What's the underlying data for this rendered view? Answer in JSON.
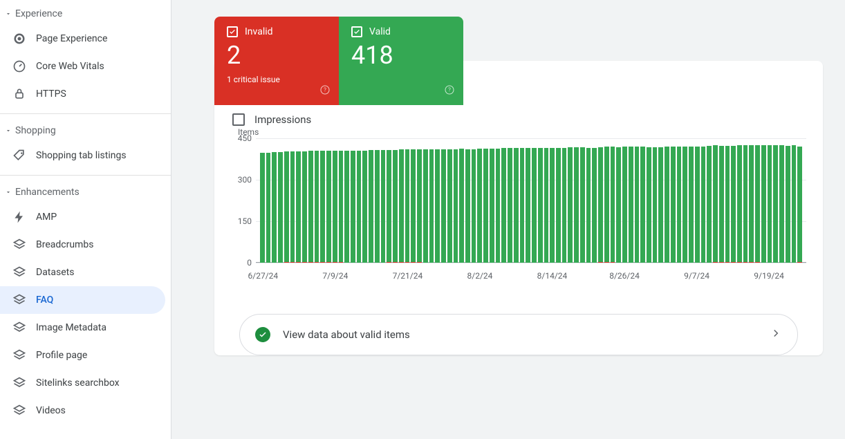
{
  "sidebar": {
    "sections": [
      {
        "title": "Experience",
        "items": [
          {
            "label": "Page Experience",
            "icon": "globe"
          },
          {
            "label": "Core Web Vitals",
            "icon": "gauge"
          },
          {
            "label": "HTTPS",
            "icon": "lock"
          }
        ]
      },
      {
        "title": "Shopping",
        "items": [
          {
            "label": "Shopping tab listings",
            "icon": "tag"
          }
        ]
      },
      {
        "title": "Enhancements",
        "items": [
          {
            "label": "AMP",
            "icon": "bolt"
          },
          {
            "label": "Breadcrumbs",
            "icon": "layers"
          },
          {
            "label": "Datasets",
            "icon": "layers"
          },
          {
            "label": "FAQ",
            "icon": "layers",
            "selected": true
          },
          {
            "label": "Image Metadata",
            "icon": "layers"
          },
          {
            "label": "Profile page",
            "icon": "layers"
          },
          {
            "label": "Sitelinks searchbox",
            "icon": "layers"
          },
          {
            "label": "Videos",
            "icon": "layers"
          }
        ]
      }
    ]
  },
  "summary": {
    "invalid": {
      "label": "Invalid",
      "value": "2",
      "note": "1 critical issue"
    },
    "valid": {
      "label": "Valid",
      "value": "418"
    }
  },
  "impressions_label": "Impressions",
  "valid_items_link": "View data about valid items",
  "chart_data": {
    "type": "bar",
    "title": "",
    "ylabel": "Items",
    "ylim": [
      0,
      450
    ],
    "yticks": [
      0,
      150,
      300,
      450
    ],
    "x_ticks": [
      "6/27/24",
      "7/9/24",
      "7/21/24",
      "8/2/24",
      "8/14/24",
      "8/26/24",
      "9/7/24",
      "9/19/24"
    ],
    "series": [
      {
        "name": "Valid",
        "color": "#34a853",
        "values": [
          398,
          398,
          399,
          399,
          400,
          400,
          401,
          401,
          402,
          402,
          403,
          403,
          404,
          404,
          405,
          405,
          406,
          406,
          407,
          407,
          407,
          406,
          406,
          407,
          407,
          408,
          408,
          409,
          409,
          410,
          410,
          411,
          411,
          412,
          411,
          410,
          412,
          412,
          413,
          413,
          414,
          414,
          415,
          415,
          416,
          416,
          415,
          414,
          415,
          416,
          416,
          417,
          417,
          417,
          416,
          415,
          416,
          417,
          418,
          418,
          419,
          419,
          420,
          420,
          418,
          417,
          418,
          419,
          421,
          419,
          420,
          420,
          421,
          421,
          422,
          422,
          421,
          420,
          421,
          422,
          422,
          423,
          424,
          425,
          425,
          425,
          424,
          423,
          424,
          418
        ]
      },
      {
        "name": "Invalid",
        "color": "#d93025",
        "values": [
          0,
          0,
          0,
          0,
          2,
          2,
          2,
          2,
          2,
          2,
          2,
          2,
          2,
          2,
          0,
          0,
          0,
          0,
          0,
          0,
          0,
          2,
          2,
          2,
          2,
          2,
          2,
          0,
          0,
          0,
          0,
          0,
          0,
          0,
          0,
          0,
          0,
          0,
          0,
          0,
          0,
          0,
          0,
          0,
          0,
          0,
          0,
          0,
          0,
          0,
          0,
          0,
          0,
          0,
          0,
          0,
          2,
          2,
          2,
          0,
          0,
          0,
          0,
          0,
          0,
          0,
          0,
          0,
          0,
          0,
          0,
          0,
          0,
          0,
          0,
          2,
          2,
          2,
          2,
          2,
          2,
          2,
          2,
          0,
          0,
          0,
          0,
          0,
          0,
          2
        ]
      }
    ]
  }
}
